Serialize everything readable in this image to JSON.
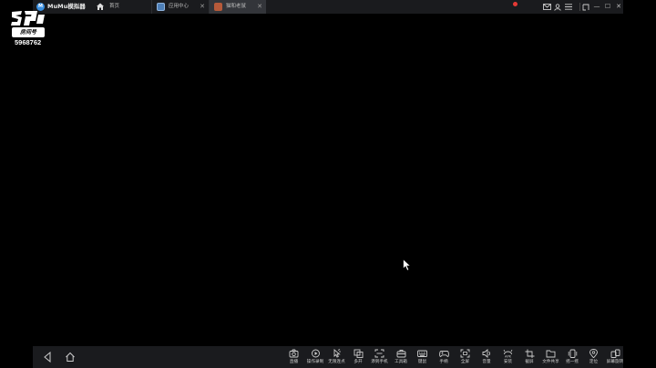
{
  "app": {
    "title": "MuMu模拟器",
    "logo_text": "M"
  },
  "tabs": [
    {
      "label": "首页"
    },
    {
      "label": "应用中心",
      "close": "✕"
    },
    {
      "label": "猫和老鼠",
      "close": "✕"
    }
  ],
  "window_controls": {
    "minimize": "—",
    "maximize": "☐",
    "close": "✕"
  },
  "watermark": {
    "room_label": "房间号",
    "room_number": "5968762"
  },
  "toolbar": {
    "items": [
      {
        "label": "直播",
        "icon": "camera-icon"
      },
      {
        "label": "操作录制",
        "icon": "record-icon"
      },
      {
        "label": "无限连点",
        "icon": "click-icon"
      },
      {
        "label": "多开",
        "icon": "multi-icon"
      },
      {
        "label": "添到手机",
        "icon": "phone-icon"
      },
      {
        "label": "工具箱",
        "icon": "toolbox-icon"
      },
      {
        "label": "键鼠",
        "icon": "keyboard-icon"
      },
      {
        "label": "手柄",
        "icon": "gamepad-icon"
      },
      {
        "label": "全屏",
        "icon": "fullscreen-icon"
      },
      {
        "label": "音量",
        "icon": "volume-icon"
      },
      {
        "label": "安装",
        "icon": "apk-icon"
      },
      {
        "label": "截屏",
        "icon": "crop-icon"
      },
      {
        "label": "文件共享",
        "icon": "folder-icon"
      },
      {
        "label": "摇一摇",
        "icon": "shake-icon"
      },
      {
        "label": "定位",
        "icon": "location-icon"
      },
      {
        "label": "屏幕旋转",
        "icon": "rotate-icon"
      }
    ]
  },
  "colors": {
    "bar": "#1a1b1e",
    "active_tab": "#33353a",
    "badge": "#e53935",
    "logo": "#3a8fe0"
  }
}
